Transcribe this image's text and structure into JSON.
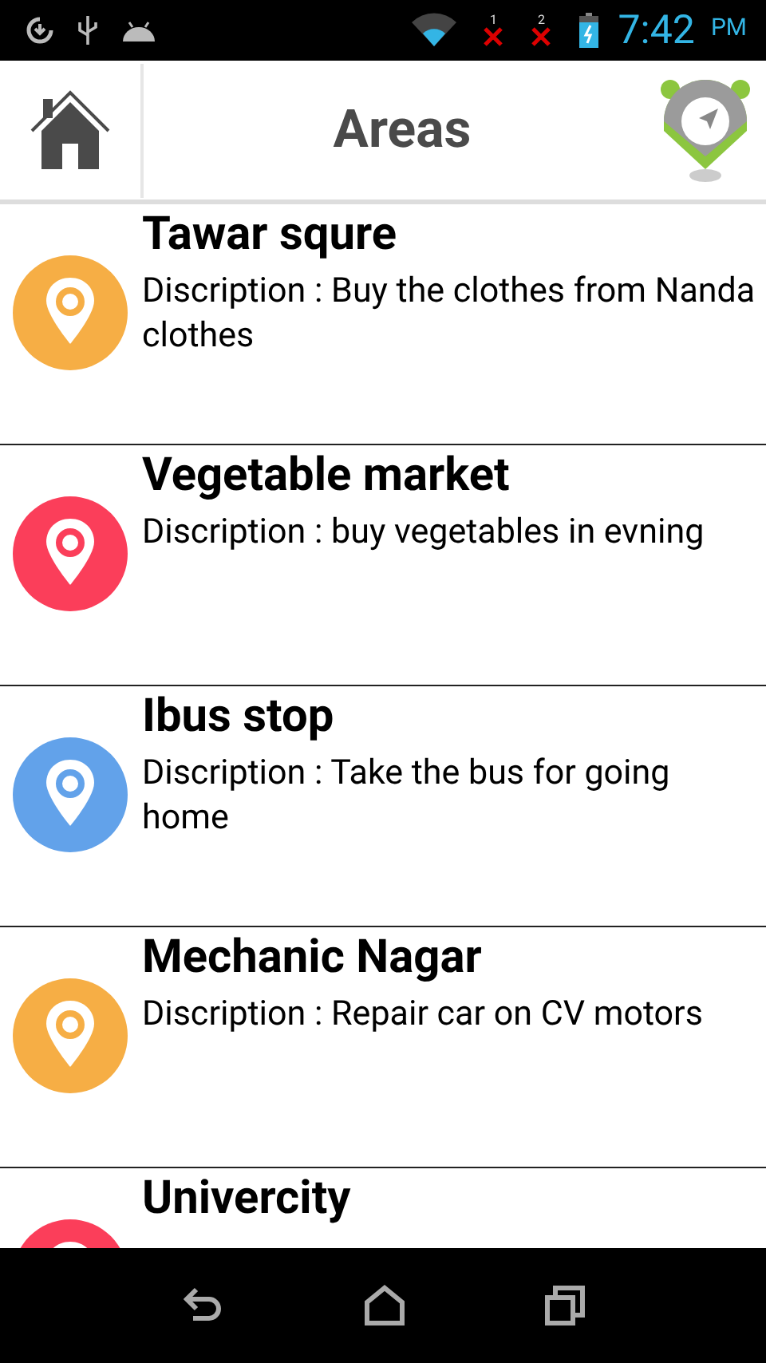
{
  "status_bar": {
    "sim_slots": [
      {
        "label": "1"
      },
      {
        "label": "2"
      }
    ],
    "time": "7:42",
    "meridiem": "PM"
  },
  "header": {
    "title": "Areas"
  },
  "areas": [
    {
      "name": "Tawar squre",
      "description": "Discription : Buy the clothes from Nanda clothes",
      "color": "#f6ae45"
    },
    {
      "name": "Vegetable market",
      "description": "Discription : buy vegetables in evning",
      "color": "#fb3e5a"
    },
    {
      "name": "Ibus stop",
      "description": "Discription : Take the bus for going home",
      "color": "#62a2ea"
    },
    {
      "name": "Mechanic Nagar",
      "description": "Discription : Repair car on CV motors",
      "color": "#f6ae45"
    },
    {
      "name": "Univercity",
      "color": "#fb3e5a"
    }
  ]
}
